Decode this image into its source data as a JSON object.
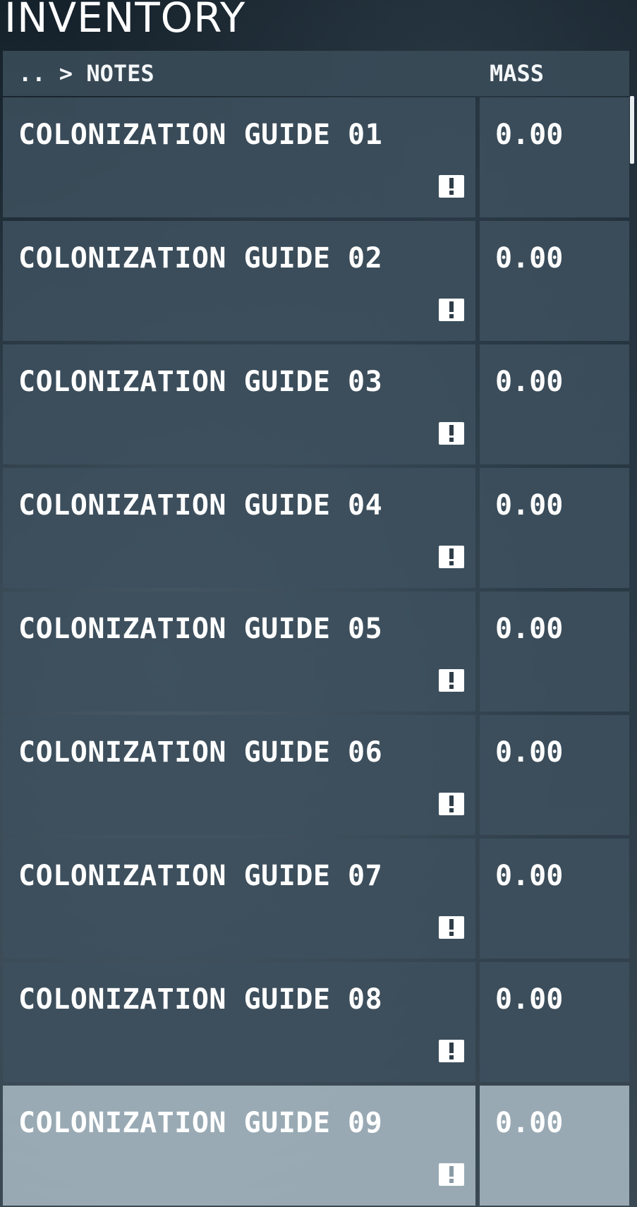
{
  "screen": {
    "title": "INVENTORY"
  },
  "header": {
    "breadcrumb": ".. > NOTES",
    "mass_label": "MASS"
  },
  "items": [
    {
      "name": "COLONIZATION GUIDE 01",
      "mass": "0.00",
      "icon": "alert-icon",
      "selected": false
    },
    {
      "name": "COLONIZATION GUIDE 02",
      "mass": "0.00",
      "icon": "alert-icon",
      "selected": false
    },
    {
      "name": "COLONIZATION GUIDE 03",
      "mass": "0.00",
      "icon": "alert-icon",
      "selected": false
    },
    {
      "name": "COLONIZATION GUIDE 04",
      "mass": "0.00",
      "icon": "alert-icon",
      "selected": false
    },
    {
      "name": "COLONIZATION GUIDE 05",
      "mass": "0.00",
      "icon": "alert-icon",
      "selected": false
    },
    {
      "name": "COLONIZATION GUIDE 06",
      "mass": "0.00",
      "icon": "alert-icon",
      "selected": false
    },
    {
      "name": "COLONIZATION GUIDE 07",
      "mass": "0.00",
      "icon": "alert-icon",
      "selected": false
    },
    {
      "name": "COLONIZATION GUIDE 08",
      "mass": "0.00",
      "icon": "alert-icon",
      "selected": false
    },
    {
      "name": "COLONIZATION GUIDE 09",
      "mass": "0.00",
      "icon": "alert-icon",
      "selected": true
    }
  ],
  "colors": {
    "row_background": "#3e505d",
    "selected_row_background": "#9eafb9",
    "text": "#ffffff"
  }
}
